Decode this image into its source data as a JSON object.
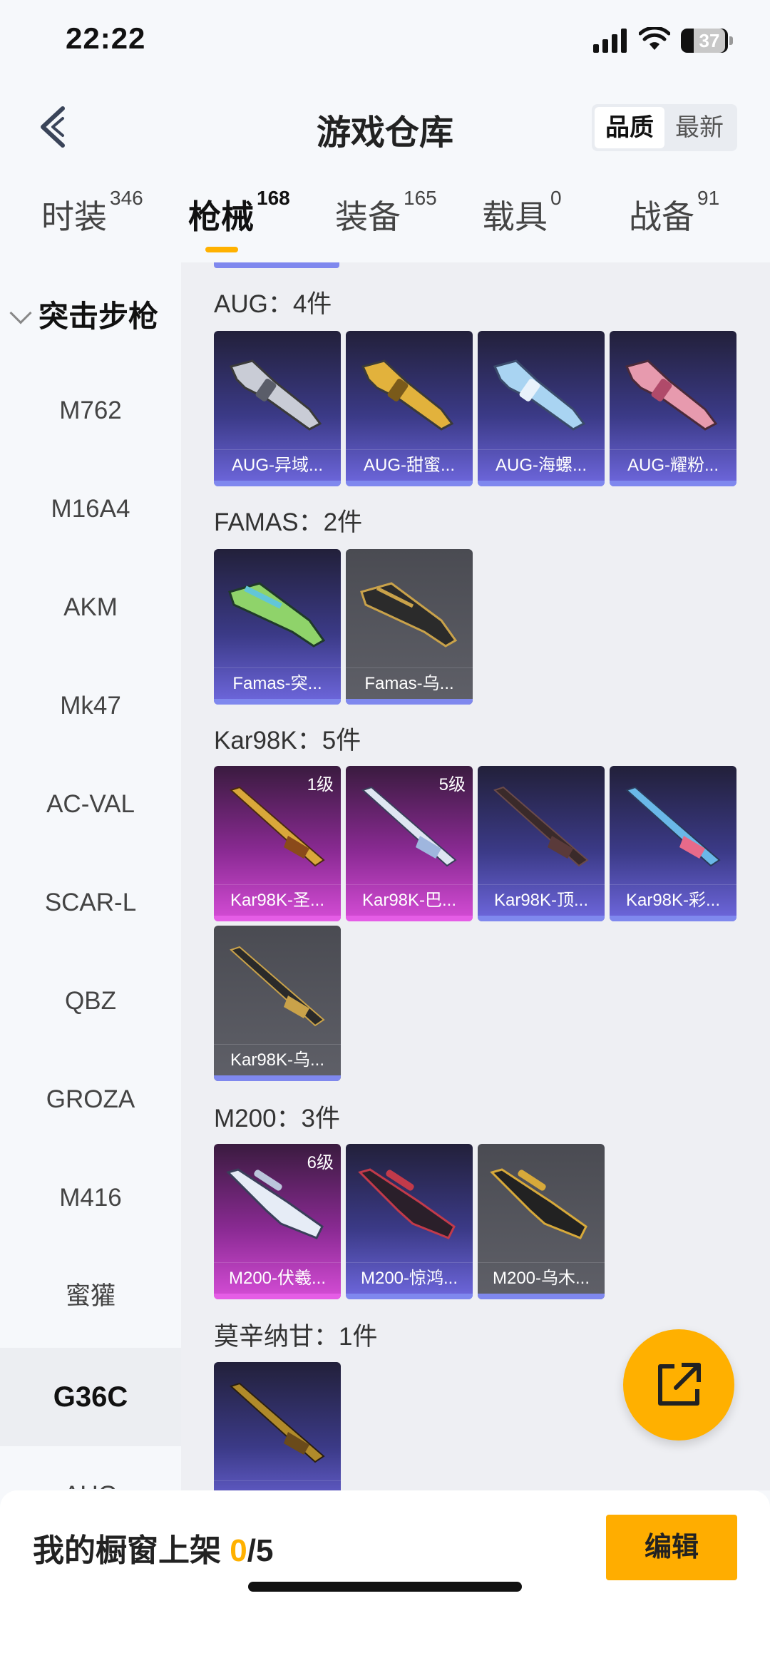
{
  "status_bar": {
    "time": "22:22",
    "battery": "37"
  },
  "header": {
    "title": "游戏仓库",
    "sort_quality": "品质",
    "sort_latest": "最新"
  },
  "tabs": [
    {
      "label": "时装",
      "count": "346"
    },
    {
      "label": "枪械",
      "count": "168"
    },
    {
      "label": "装备",
      "count": "165"
    },
    {
      "label": "载具",
      "count": "0"
    },
    {
      "label": "战备",
      "count": "91"
    }
  ],
  "sidebar": {
    "section": "突击步枪",
    "items": [
      "M762",
      "M16A4",
      "AKM",
      "Mk47",
      "AC-VAL",
      "SCAR-L",
      "QBZ",
      "GROZA",
      "M416",
      "蜜獾",
      "G36C",
      "AUG"
    ]
  },
  "groups": [
    {
      "title": "AUG：4件",
      "cards": [
        {
          "name": "AUG-异域...",
          "level": ""
        },
        {
          "name": "AUG-甜蜜...",
          "level": ""
        },
        {
          "name": "AUG-海螺...",
          "level": ""
        },
        {
          "name": "AUG-耀粉...",
          "level": ""
        }
      ]
    },
    {
      "title": "FAMAS：2件",
      "cards": [
        {
          "name": "Famas-突...",
          "level": ""
        },
        {
          "name": "Famas-乌...",
          "level": ""
        }
      ]
    },
    {
      "title": "Kar98K：5件",
      "cards": [
        {
          "name": "Kar98K-圣...",
          "level": "1级"
        },
        {
          "name": "Kar98K-巴...",
          "level": "5级"
        },
        {
          "name": "Kar98K-顶...",
          "level": ""
        },
        {
          "name": "Kar98K-彩...",
          "level": ""
        },
        {
          "name": "Kar98K-乌...",
          "level": ""
        }
      ]
    },
    {
      "title": "M200：3件",
      "cards": [
        {
          "name": "M200-伏羲...",
          "level": "6级"
        },
        {
          "name": "M200-惊鸿...",
          "level": ""
        },
        {
          "name": "M200-乌木...",
          "level": ""
        }
      ]
    },
    {
      "title": "莫辛纳甘：1件",
      "cards": [
        {
          "name": "",
          "level": ""
        }
      ]
    }
  ],
  "bottom": {
    "shelf_label": "我的橱窗上架",
    "shelf_count": "0",
    "shelf_total": "/5",
    "edit": "编辑"
  },
  "colors": {
    "accent": "#ffb100",
    "rare_purple": "#7f88ee",
    "legendary_pink": "#e55de6"
  }
}
